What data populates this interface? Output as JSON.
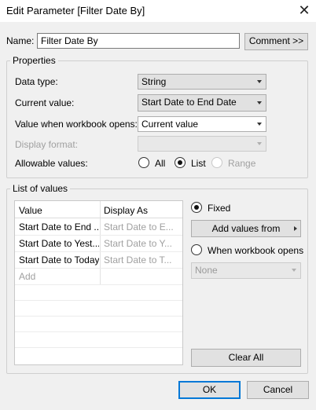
{
  "window": {
    "title": "Edit Parameter [Filter Date By]"
  },
  "name": {
    "label": "Name:",
    "value": "Filter Date By",
    "comment_button": "Comment >>"
  },
  "properties": {
    "group_label": "Properties",
    "data_type": {
      "label": "Data type:",
      "value": "String"
    },
    "current_value": {
      "label": "Current value:",
      "value": "Start Date to End Date"
    },
    "workbook_opens": {
      "label": "Value when workbook opens:",
      "value": "Current value"
    },
    "display_format": {
      "label": "Display format:",
      "value": ""
    },
    "allowable_values": {
      "label": "Allowable values:",
      "options": [
        "All",
        "List",
        "Range"
      ],
      "selected": "List"
    }
  },
  "list_of_values": {
    "group_label": "List of values",
    "columns": [
      "Value",
      "Display As"
    ],
    "rows": [
      {
        "value": "Start Date to End ...",
        "display": "Start Date to E..."
      },
      {
        "value": "Start Date to Yest...",
        "display": "Start Date to Y..."
      },
      {
        "value": "Start Date to Today",
        "display": "Start Date to T..."
      }
    ],
    "add_label": "Add",
    "fixed_label": "Fixed",
    "add_values_from": "Add values from",
    "when_workbook_opens_label": "When workbook opens",
    "when_workbook_opens_value": "None",
    "clear_all": "Clear All"
  },
  "footer": {
    "ok": "OK",
    "cancel": "Cancel"
  }
}
